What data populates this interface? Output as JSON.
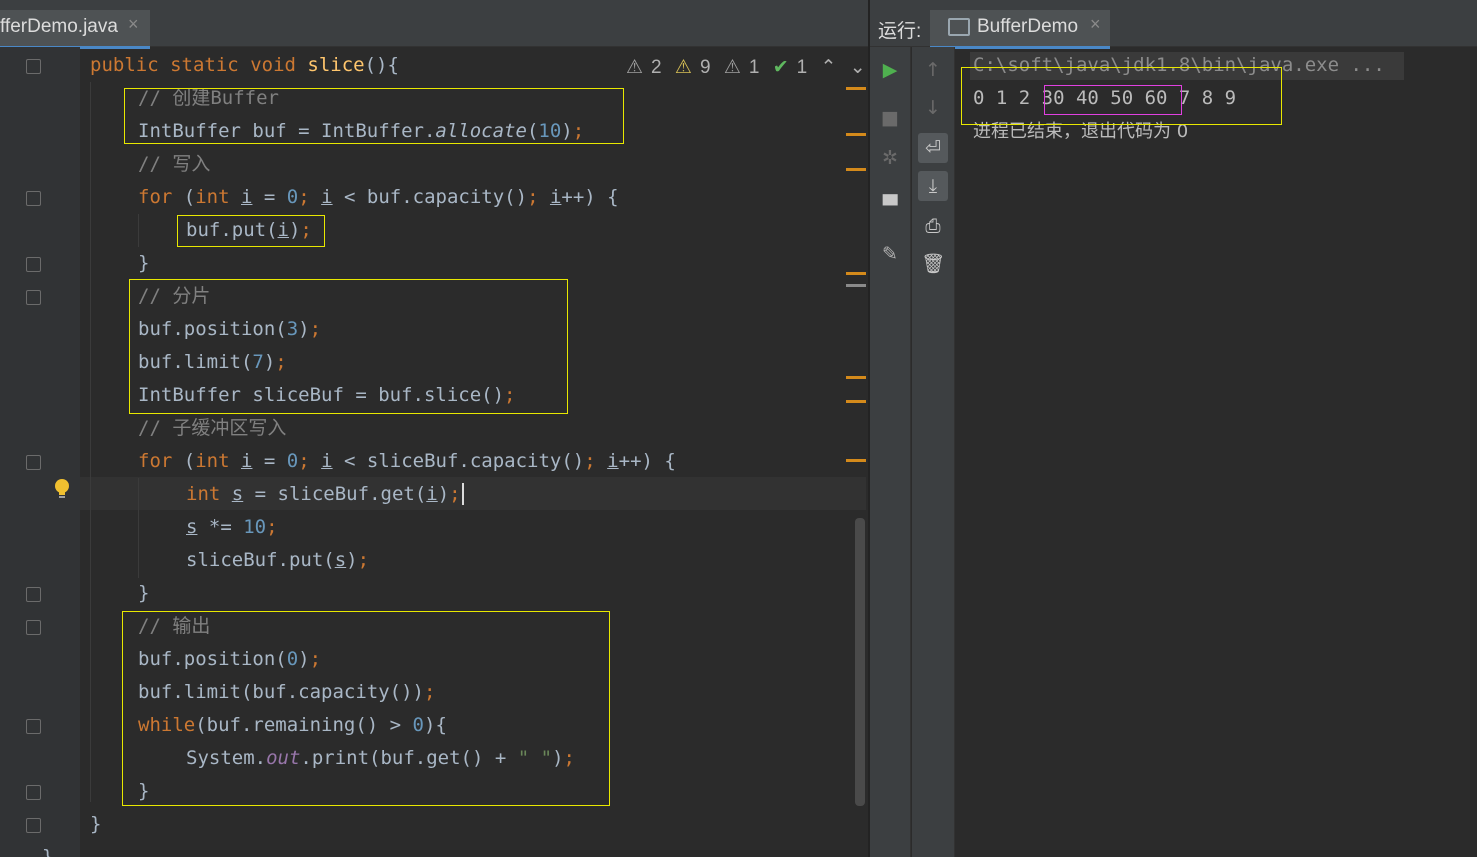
{
  "editor": {
    "tab_label": "fferDemo.java",
    "tab_close": "×",
    "inspections": {
      "w1": "2",
      "w2": "9",
      "w3": "1",
      "ok": "1",
      "up": "⌃",
      "down": "⌄"
    }
  },
  "code": {
    "l1": [
      "public",
      " ",
      "static",
      " ",
      "void",
      " ",
      "slice",
      "(){"
    ],
    "l2": "// 创建Buffer",
    "l3": [
      "IntBuffer buf = IntBuffer.",
      "allocate",
      "(",
      "10",
      ")",
      ";"
    ],
    "l4": "// 写入",
    "l5": [
      "for",
      " (",
      "int",
      " ",
      "i",
      " = ",
      "0",
      ";",
      " ",
      "i",
      " < buf.capacity()",
      ";",
      " ",
      "i",
      "++) {"
    ],
    "l6": [
      "buf.put(",
      "i",
      ")",
      ";"
    ],
    "l7": "}",
    "l8": "// 分片",
    "l9": [
      "buf.position(",
      "3",
      ")",
      ";"
    ],
    "l10": [
      "buf.limit(",
      "7",
      ")",
      ";"
    ],
    "l11": [
      "IntBuffer sliceBuf = buf.slice()",
      ";"
    ],
    "l12": "// 子缓冲区写入",
    "l13": [
      "for",
      " (",
      "int",
      " ",
      "i",
      " = ",
      "0",
      ";",
      " ",
      "i",
      " < sliceBuf.capacity()",
      ";",
      " ",
      "i",
      "++) {"
    ],
    "l14": [
      "int",
      " ",
      "s",
      " = sliceBuf.get(",
      "i",
      ")",
      ";"
    ],
    "l15": [
      "s",
      " *= ",
      "10",
      ";"
    ],
    "l16": [
      "sliceBuf.put(",
      "s",
      ")",
      ";"
    ],
    "l17": "}",
    "l18": "// 输出",
    "l19": [
      "buf.position(",
      "0",
      ")",
      ";"
    ],
    "l20": [
      "buf.limit(buf.capacity())",
      ";"
    ],
    "l21": [
      "while",
      "(buf.remaining() > ",
      "0",
      "){"
    ],
    "l22": [
      "System.",
      "out",
      ".print(buf.get() + ",
      "\" \"",
      ")",
      ";"
    ],
    "l23": "}",
    "l24": "}",
    "l25": "}"
  },
  "run_panel": {
    "title": "运行:",
    "tab_label": "BufferDemo",
    "tab_close": "×",
    "command": "C:\\soft\\java\\jdk1.8\\bin\\java.exe ...",
    "output_pre": "0 1 2 ",
    "output_mid": "30 40 50 60",
    "output_post": " 7 8 9",
    "exit_msg": "进程已结束，退出代码为 0"
  },
  "colors": {
    "keyword": "#cc7832",
    "number": "#6897bb",
    "comment": "#808080",
    "method": "#ffc66d",
    "highlight_box": "#e8e800",
    "slice_box": "#e040e0"
  }
}
